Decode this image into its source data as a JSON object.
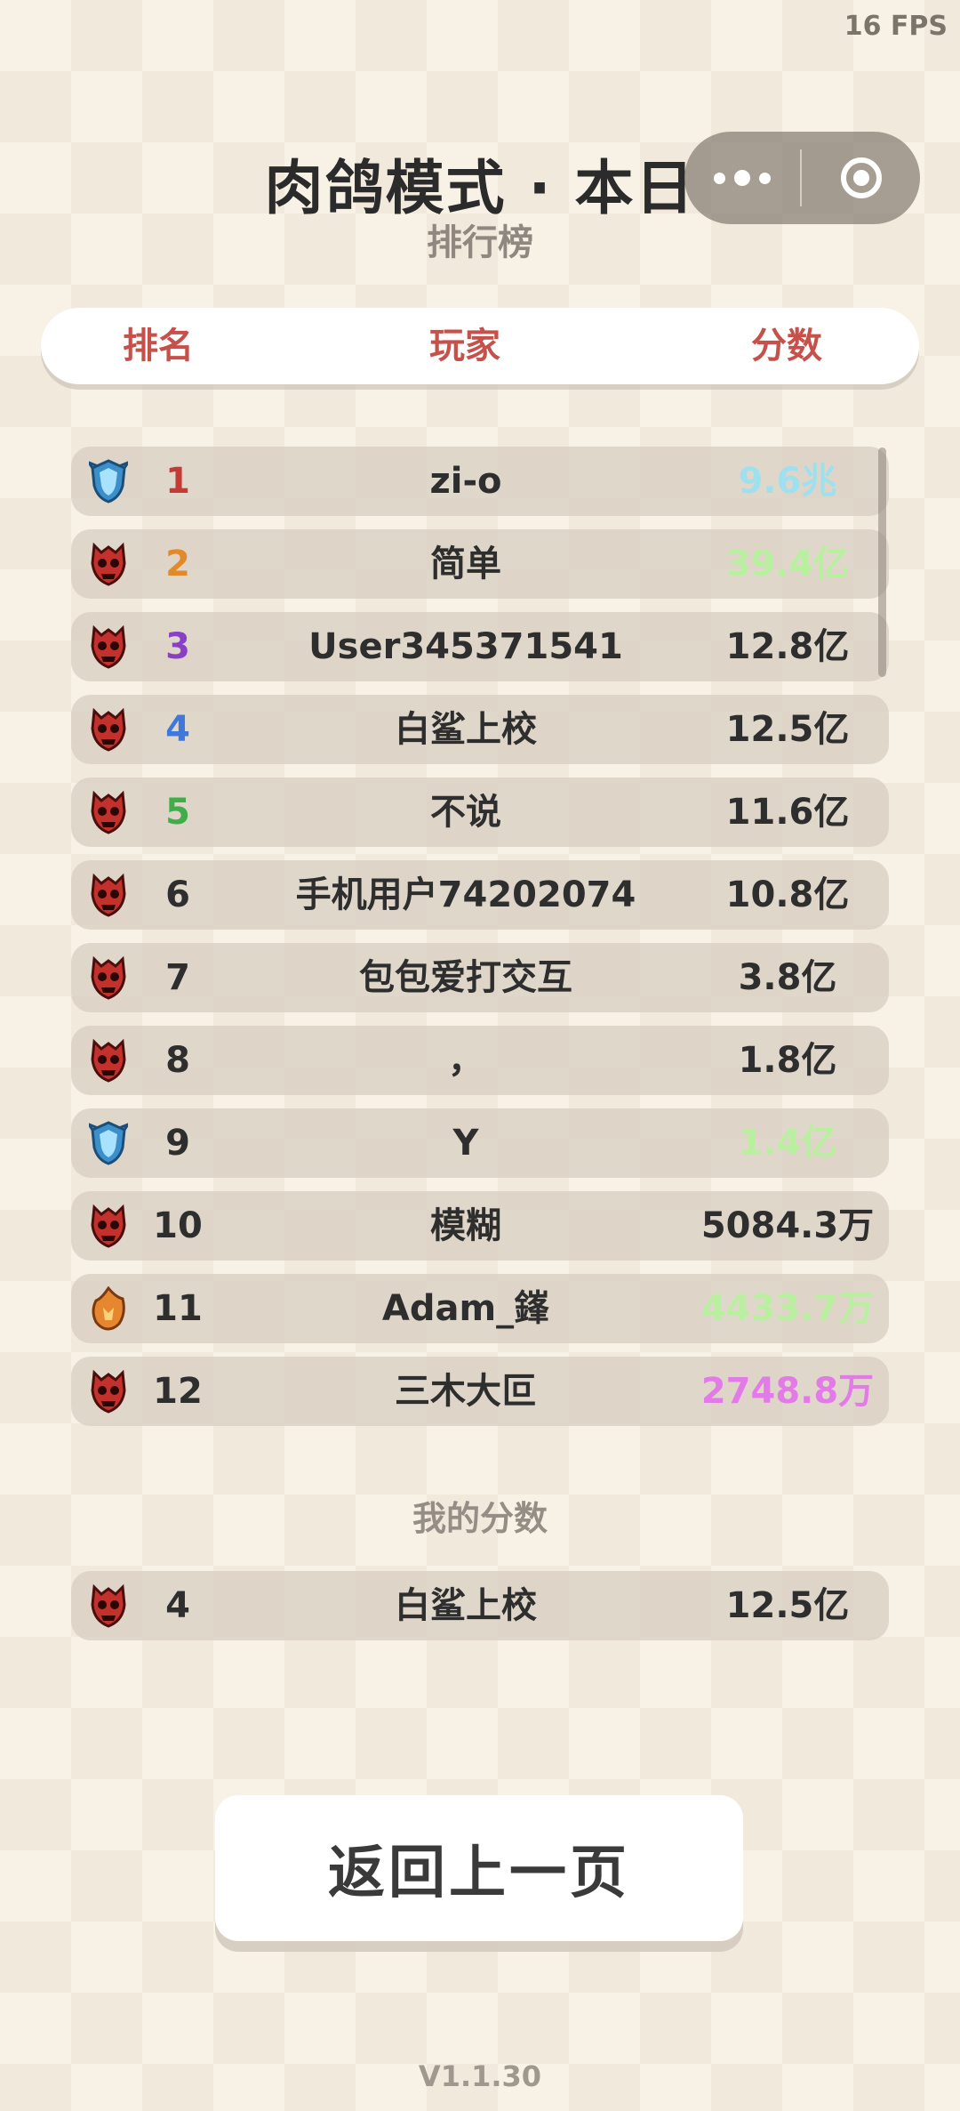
{
  "status": {
    "fps": "16 FPS"
  },
  "header": {
    "title": "肉鸽模式 · 本日",
    "subtitle": "排行榜"
  },
  "capsule": {
    "more_icon": "more-dots-icon",
    "close_icon": "target-circle-icon"
  },
  "columns": {
    "rank": "排名",
    "player": "玩家",
    "score": "分数"
  },
  "rows": [
    {
      "rank": "1",
      "rank_color": "#c43a35",
      "badge": "blue-shield",
      "player": "zi-o",
      "score": "9.6兆",
      "score_color": "#9fe0ee"
    },
    {
      "rank": "2",
      "rank_color": "#e08a2c",
      "badge": "red-skull",
      "player": "简单",
      "score": "39.4亿",
      "score_color": "#b9f0a0"
    },
    {
      "rank": "3",
      "rank_color": "#8a3fc7",
      "badge": "red-skull",
      "player": "User345371541",
      "score": "12.8亿",
      "score_color": "#2e2e2e"
    },
    {
      "rank": "4",
      "rank_color": "#3f78d8",
      "badge": "red-skull",
      "player": "白鲨上校",
      "score": "12.5亿",
      "score_color": "#2e2e2e"
    },
    {
      "rank": "5",
      "rank_color": "#3fae4a",
      "badge": "red-skull",
      "player": "不说",
      "score": "11.6亿",
      "score_color": "#2e2e2e"
    },
    {
      "rank": "6",
      "rank_color": "#2e2e2e",
      "badge": "red-skull",
      "player": "手机用户74202074",
      "score": "10.8亿",
      "score_color": "#2e2e2e"
    },
    {
      "rank": "7",
      "rank_color": "#2e2e2e",
      "badge": "red-skull",
      "player": "包包爱打交互",
      "score": "3.8亿",
      "score_color": "#2e2e2e"
    },
    {
      "rank": "8",
      "rank_color": "#2e2e2e",
      "badge": "red-skull",
      "player": "，",
      "score": "1.8亿",
      "score_color": "#2e2e2e"
    },
    {
      "rank": "9",
      "rank_color": "#2e2e2e",
      "badge": "blue-shield",
      "player": "Y",
      "score": "1.4亿",
      "score_color": "#b9f0a0"
    },
    {
      "rank": "10",
      "rank_color": "#2e2e2e",
      "badge": "red-skull",
      "player": "模糊",
      "score": "5084.3万",
      "score_color": "#2e2e2e"
    },
    {
      "rank": "11",
      "rank_color": "#2e2e2e",
      "badge": "orange-flame",
      "player": "Adam_鎽",
      "score": "4433.7万",
      "score_color": "#b9f0a0"
    },
    {
      "rank": "12",
      "rank_color": "#2e2e2e",
      "badge": "red-skull",
      "player": "三木大叵",
      "score": "2748.8万",
      "score_color": "#e27ae8"
    }
  ],
  "my_score": {
    "title": "我的分数",
    "rank": "4",
    "rank_color": "#2e2e2e",
    "badge": "red-skull",
    "player": "白鲨上校",
    "score": "12.5亿",
    "score_color": "#2e2e2e"
  },
  "back_button": {
    "label": "返回上一页"
  },
  "footer": {
    "version": "V1.1.30"
  }
}
